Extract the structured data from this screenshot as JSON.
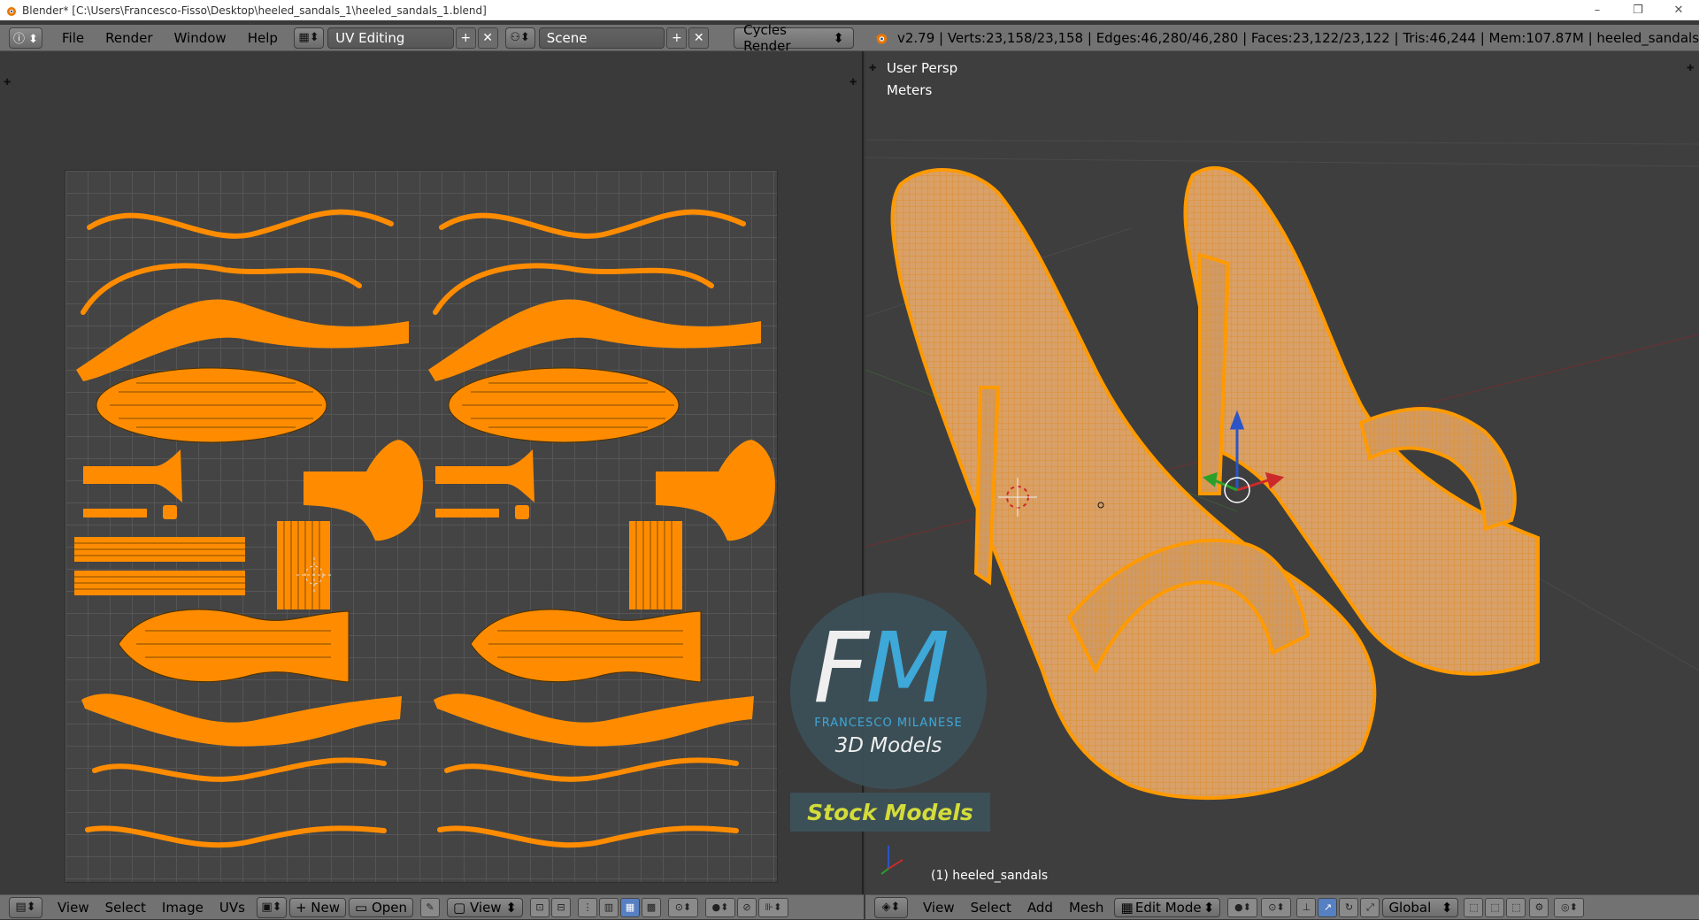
{
  "window": {
    "title": "Blender* [C:\\Users\\Francesco-Fisso\\Desktop\\heeled_sandals_1\\heeled_sandals_1.blend]",
    "controls": {
      "minimize": "–",
      "restore": "❐",
      "close": "✕"
    }
  },
  "menubar": {
    "menus": [
      "File",
      "Render",
      "Window",
      "Help"
    ],
    "screen_layout": "UV Editing",
    "scene": "Scene",
    "render_engine": "Cycles Render",
    "stats": "v2.79 | Verts:23,158/23,158 | Edges:46,280/46,280 | Faces:23,122/23,122 | Tris:46,244 | Mem:107.87M | heeled_sandals"
  },
  "viewport": {
    "view_name": "User Persp",
    "units": "Meters",
    "object_label": "(1) heeled_sandals"
  },
  "watermark": {
    "f": "F",
    "m": "M",
    "name": "FRANCESCO MILANESE",
    "subtitle": "3D Models",
    "badge": "Stock Models"
  },
  "uv_footer": {
    "menus": [
      "View",
      "Select",
      "Image",
      "UVs"
    ],
    "new_label": "New",
    "open_label": "Open",
    "view_label": "View"
  },
  "view3d_footer": {
    "menus": [
      "View",
      "Select",
      "Add",
      "Mesh"
    ],
    "mode": "Edit Mode",
    "orientation": "Global"
  },
  "colors": {
    "accent_orange": "#ff8c00",
    "uv_grid": "#444444",
    "header": "#727272",
    "logo_blue": "#3fb1e6",
    "badge_text": "#d3dc3a"
  },
  "icons": [
    "blender-logo-icon",
    "info-icon",
    "screen-layout-icon",
    "scene-icon",
    "add-icon",
    "close-icon",
    "editor-type-icon",
    "pin-icon",
    "cursor-icon",
    "snap-icon",
    "pivot-icon",
    "shading-icon",
    "axis-gizmo-icon"
  ]
}
